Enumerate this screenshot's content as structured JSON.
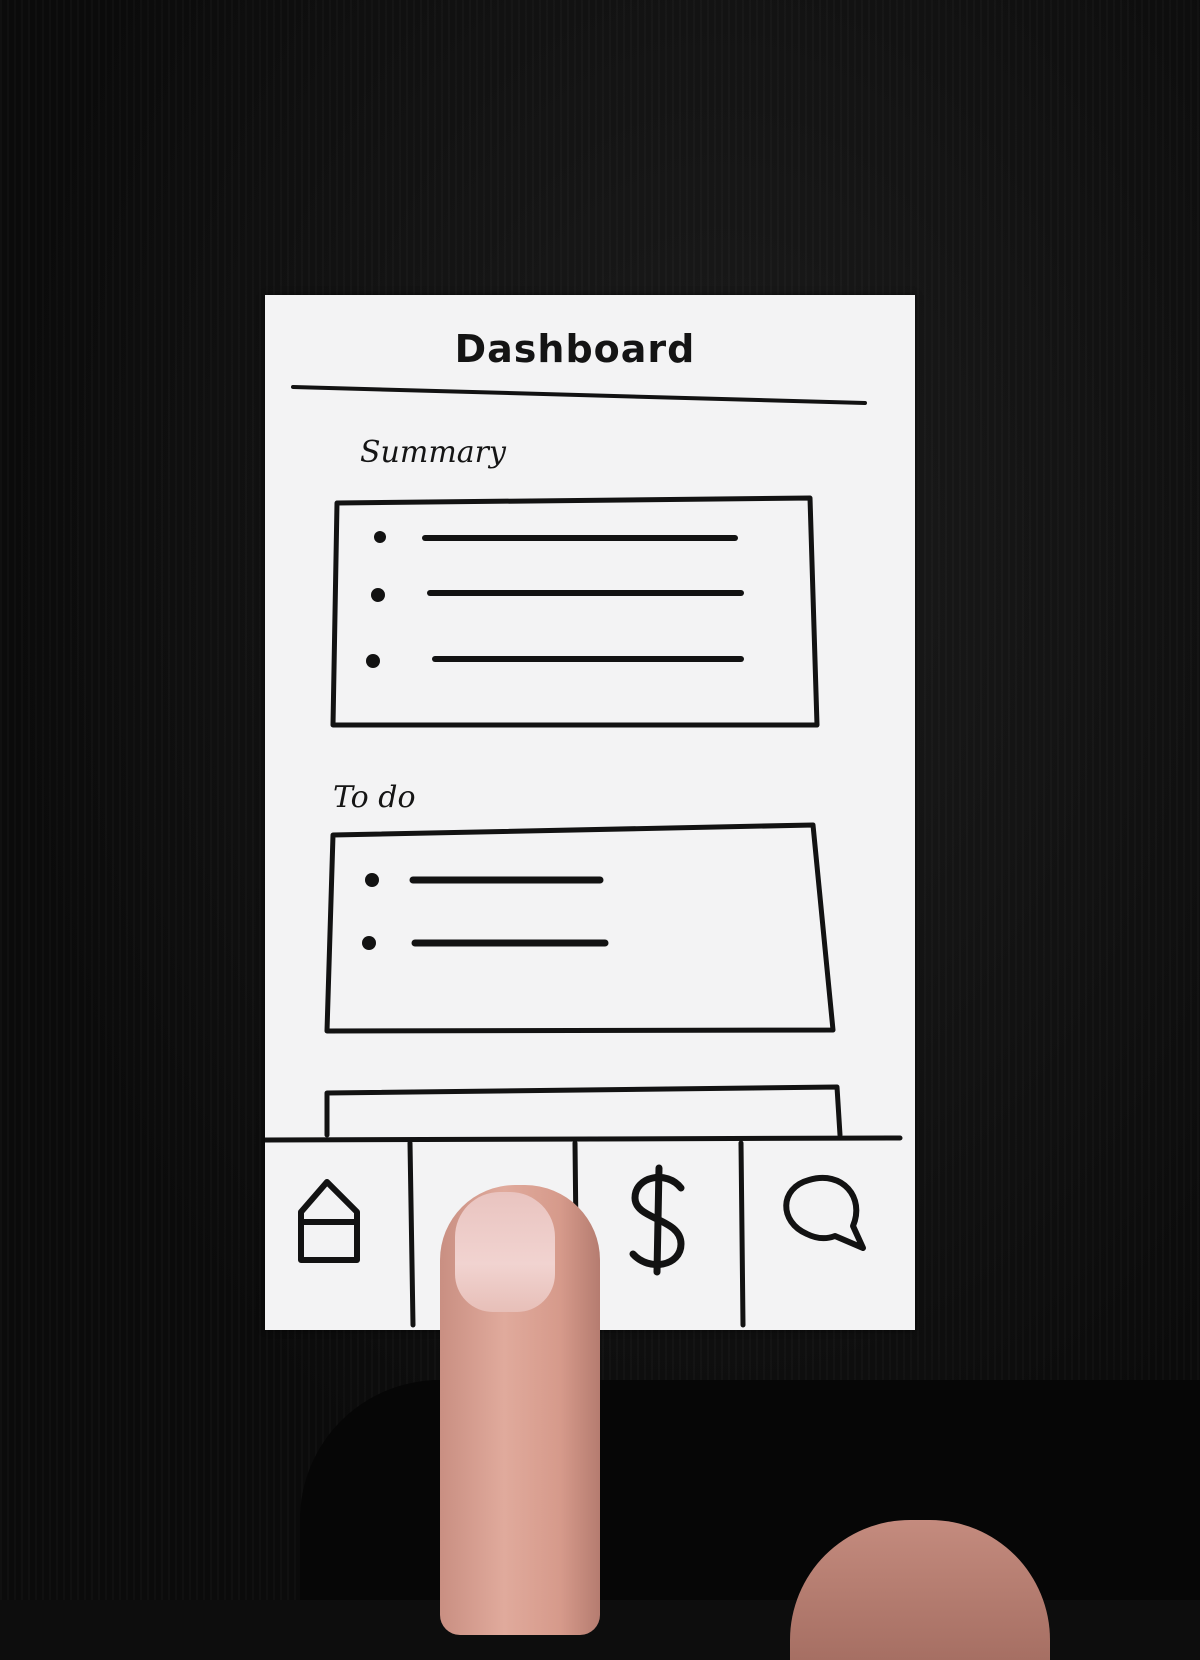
{
  "screen": {
    "title": "Dashboard"
  },
  "sections": {
    "summary": {
      "label": "Summary",
      "item_count": 3
    },
    "todo": {
      "label": "To do",
      "item_count": 2
    }
  },
  "tab_bar": {
    "tabs": [
      {
        "name": "home",
        "icon": "home-icon"
      },
      {
        "name": "blank",
        "icon": "none"
      },
      {
        "name": "money",
        "icon": "dollar-icon",
        "glyph": "$"
      },
      {
        "name": "chat",
        "icon": "chat-bubble-icon"
      }
    ]
  }
}
